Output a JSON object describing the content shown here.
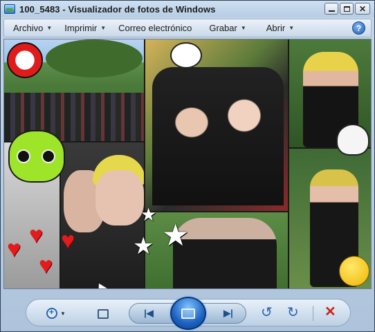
{
  "window": {
    "title": "100_5483 - Visualizador de fotos de Windows"
  },
  "menubar": {
    "items": [
      {
        "label": "Archivo",
        "has_dropdown": true
      },
      {
        "label": "Imprimir",
        "has_dropdown": true
      },
      {
        "label": "Correo electrónico",
        "has_dropdown": false
      },
      {
        "label": "Grabar",
        "has_dropdown": true
      },
      {
        "label": "Abrir",
        "has_dropdown": true
      }
    ],
    "help_label": "?"
  },
  "photo": {
    "description_icons": [
      "skull-sticker",
      "alien-sticker",
      "heart-stickers",
      "star-stickers",
      "smiley-sticker",
      "ghost-sticker",
      "hello-kitty-sticker"
    ]
  },
  "toolbar": {
    "zoom_icon": "zoom-icon",
    "fit_icon": "actual-size-icon",
    "prev_icon": "previous-icon",
    "slideshow_icon": "slideshow-icon",
    "next_icon": "next-icon",
    "rotate_ccw_icon": "rotate-counterclockwise-icon",
    "rotate_cw_icon": "rotate-clockwise-icon",
    "delete_icon": "delete-icon",
    "accent": "#1d62c2",
    "delete_color": "#c9261b"
  }
}
